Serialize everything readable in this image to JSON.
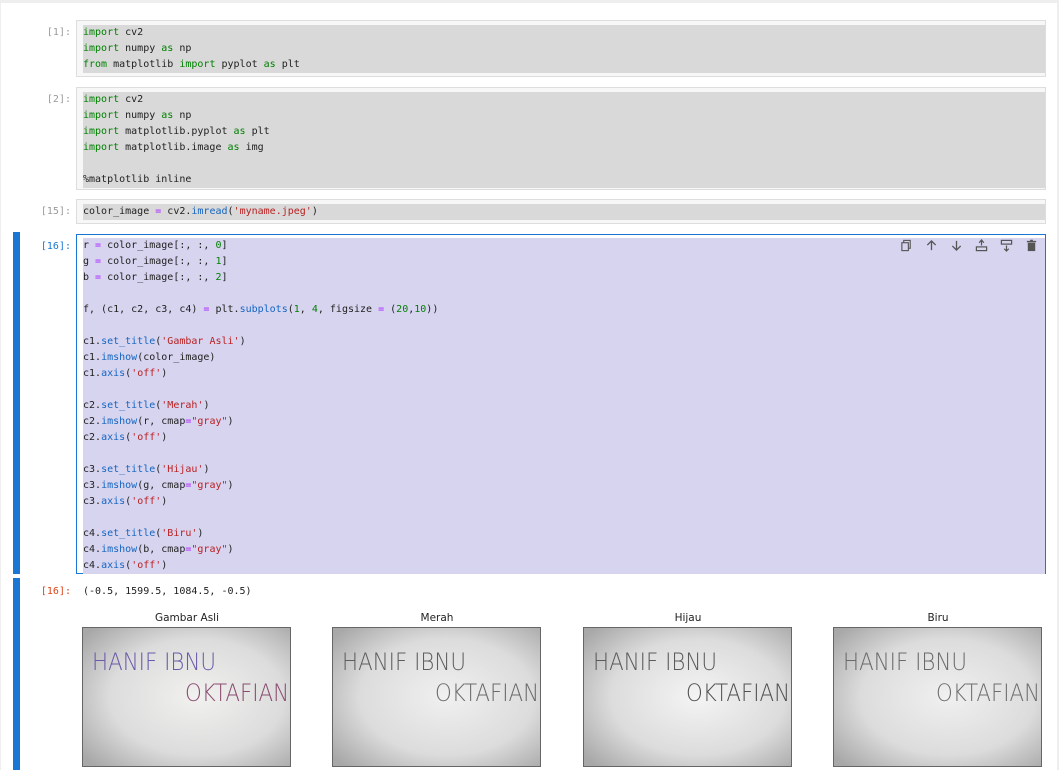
{
  "cells": [
    {
      "prompt": "[1]:",
      "lines": [
        [
          {
            "t": "import",
            "c": "kw"
          },
          {
            "t": " cv2"
          }
        ],
        [
          {
            "t": "import",
            "c": "kw"
          },
          {
            "t": " numpy "
          },
          {
            "t": "as",
            "c": "kw"
          },
          {
            "t": " np"
          }
        ],
        [
          {
            "t": "from",
            "c": "kw"
          },
          {
            "t": " matplotlib "
          },
          {
            "t": "import",
            "c": "kw"
          },
          {
            "t": " pyplot "
          },
          {
            "t": "as",
            "c": "kw"
          },
          {
            "t": " plt"
          }
        ]
      ]
    },
    {
      "prompt": "[2]:",
      "lines": [
        [
          {
            "t": "import",
            "c": "kw"
          },
          {
            "t": " cv2"
          }
        ],
        [
          {
            "t": "import",
            "c": "kw"
          },
          {
            "t": " numpy "
          },
          {
            "t": "as",
            "c": "kw"
          },
          {
            "t": " np"
          }
        ],
        [
          {
            "t": "import",
            "c": "kw"
          },
          {
            "t": " matplotlib.pyplot "
          },
          {
            "t": "as",
            "c": "kw"
          },
          {
            "t": " plt"
          }
        ],
        [
          {
            "t": "import",
            "c": "kw"
          },
          {
            "t": " matplotlib.image "
          },
          {
            "t": "as",
            "c": "kw"
          },
          {
            "t": " img"
          }
        ],
        [],
        [
          {
            "t": "%matplotlib inline"
          }
        ]
      ]
    },
    {
      "prompt": "[15]:",
      "lines": [
        [
          {
            "t": "color_image "
          },
          {
            "t": "=",
            "c": "op"
          },
          {
            "t": " cv2."
          },
          {
            "t": "imread",
            "c": "fn"
          },
          {
            "t": "("
          },
          {
            "t": "'myname.jpeg'",
            "c": "st"
          },
          {
            "t": ")"
          }
        ]
      ]
    },
    {
      "prompt": "[16]:",
      "lines": [
        [
          {
            "t": "r "
          },
          {
            "t": "=",
            "c": "op"
          },
          {
            "t": " color_image[:, :, "
          },
          {
            "t": "0",
            "c": "nu"
          },
          {
            "t": "]"
          }
        ],
        [
          {
            "t": "g "
          },
          {
            "t": "=",
            "c": "op"
          },
          {
            "t": " color_image[:, :, "
          },
          {
            "t": "1",
            "c": "nu"
          },
          {
            "t": "]"
          }
        ],
        [
          {
            "t": "b "
          },
          {
            "t": "=",
            "c": "op"
          },
          {
            "t": " color_image[:, :, "
          },
          {
            "t": "2",
            "c": "nu"
          },
          {
            "t": "]"
          }
        ],
        [],
        [
          {
            "t": "f, (c1, c2, c3, c4) "
          },
          {
            "t": "=",
            "c": "op"
          },
          {
            "t": " plt."
          },
          {
            "t": "subplots",
            "c": "fn"
          },
          {
            "t": "("
          },
          {
            "t": "1",
            "c": "nu"
          },
          {
            "t": ", "
          },
          {
            "t": "4",
            "c": "nu"
          },
          {
            "t": ", figsize "
          },
          {
            "t": "=",
            "c": "op"
          },
          {
            "t": " ("
          },
          {
            "t": "20",
            "c": "nu"
          },
          {
            "t": ","
          },
          {
            "t": "10",
            "c": "nu"
          },
          {
            "t": "))"
          }
        ],
        [],
        [
          {
            "t": "c1."
          },
          {
            "t": "set_title",
            "c": "fn"
          },
          {
            "t": "("
          },
          {
            "t": "'Gambar Asli'",
            "c": "st"
          },
          {
            "t": ")"
          }
        ],
        [
          {
            "t": "c1."
          },
          {
            "t": "imshow",
            "c": "fn"
          },
          {
            "t": "(color_image)"
          }
        ],
        [
          {
            "t": "c1."
          },
          {
            "t": "axis",
            "c": "fn"
          },
          {
            "t": "("
          },
          {
            "t": "'off'",
            "c": "st"
          },
          {
            "t": ")"
          }
        ],
        [],
        [
          {
            "t": "c2."
          },
          {
            "t": "set_title",
            "c": "fn"
          },
          {
            "t": "("
          },
          {
            "t": "'Merah'",
            "c": "st"
          },
          {
            "t": ")"
          }
        ],
        [
          {
            "t": "c2."
          },
          {
            "t": "imshow",
            "c": "fn"
          },
          {
            "t": "(r, cmap"
          },
          {
            "t": "=",
            "c": "op"
          },
          {
            "t": "\"gray\"",
            "c": "st"
          },
          {
            "t": ")"
          }
        ],
        [
          {
            "t": "c2."
          },
          {
            "t": "axis",
            "c": "fn"
          },
          {
            "t": "("
          },
          {
            "t": "'off'",
            "c": "st"
          },
          {
            "t": ")"
          }
        ],
        [],
        [
          {
            "t": "c3."
          },
          {
            "t": "set_title",
            "c": "fn"
          },
          {
            "t": "("
          },
          {
            "t": "'Hijau'",
            "c": "st"
          },
          {
            "t": ")"
          }
        ],
        [
          {
            "t": "c3."
          },
          {
            "t": "imshow",
            "c": "fn"
          },
          {
            "t": "(g, cmap"
          },
          {
            "t": "=",
            "c": "op"
          },
          {
            "t": "\"gray\"",
            "c": "st"
          },
          {
            "t": ")"
          }
        ],
        [
          {
            "t": "c3."
          },
          {
            "t": "axis",
            "c": "fn"
          },
          {
            "t": "("
          },
          {
            "t": "'off'",
            "c": "st"
          },
          {
            "t": ")"
          }
        ],
        [],
        [
          {
            "t": "c4."
          },
          {
            "t": "set_title",
            "c": "fn"
          },
          {
            "t": "("
          },
          {
            "t": "'Biru'",
            "c": "st"
          },
          {
            "t": ")"
          }
        ],
        [
          {
            "t": "c4."
          },
          {
            "t": "imshow",
            "c": "fn"
          },
          {
            "t": "(b, cmap"
          },
          {
            "t": "=",
            "c": "op"
          },
          {
            "t": "\"gray\"",
            "c": "st"
          },
          {
            "t": ")"
          }
        ],
        [
          {
            "t": "c4."
          },
          {
            "t": "axis",
            "c": "fn"
          },
          {
            "t": "("
          },
          {
            "t": "'off'",
            "c": "st"
          },
          {
            "t": ")"
          }
        ]
      ]
    }
  ],
  "toolbar": {
    "icons": [
      "duplicate-icon",
      "move-up-icon",
      "move-down-icon",
      "insert-above-icon",
      "insert-below-icon",
      "delete-icon"
    ]
  },
  "output": {
    "prompt": "[16]:",
    "text": "(-0.5, 1599.5, 1084.5, -0.5)",
    "figures": [
      {
        "title": "Gambar Asli",
        "word1": "HANIF IBNU",
        "word2": "OKTAFIAN",
        "mode": "color"
      },
      {
        "title": "Merah",
        "word1": "HANIF IBNU",
        "word2": "OKTAFIAN",
        "mode": "red"
      },
      {
        "title": "Hijau",
        "word1": "HANIF IBNU",
        "word2": "OKTAFIAN",
        "mode": "green"
      },
      {
        "title": "Biru",
        "word1": "HANIF IBNU",
        "word2": "OKTAFIAN",
        "mode": "blue"
      }
    ]
  },
  "colors": {
    "accent": "#1976d2",
    "keyword": "#008000",
    "string": "#ba2121",
    "out_prompt": "#d84315"
  }
}
